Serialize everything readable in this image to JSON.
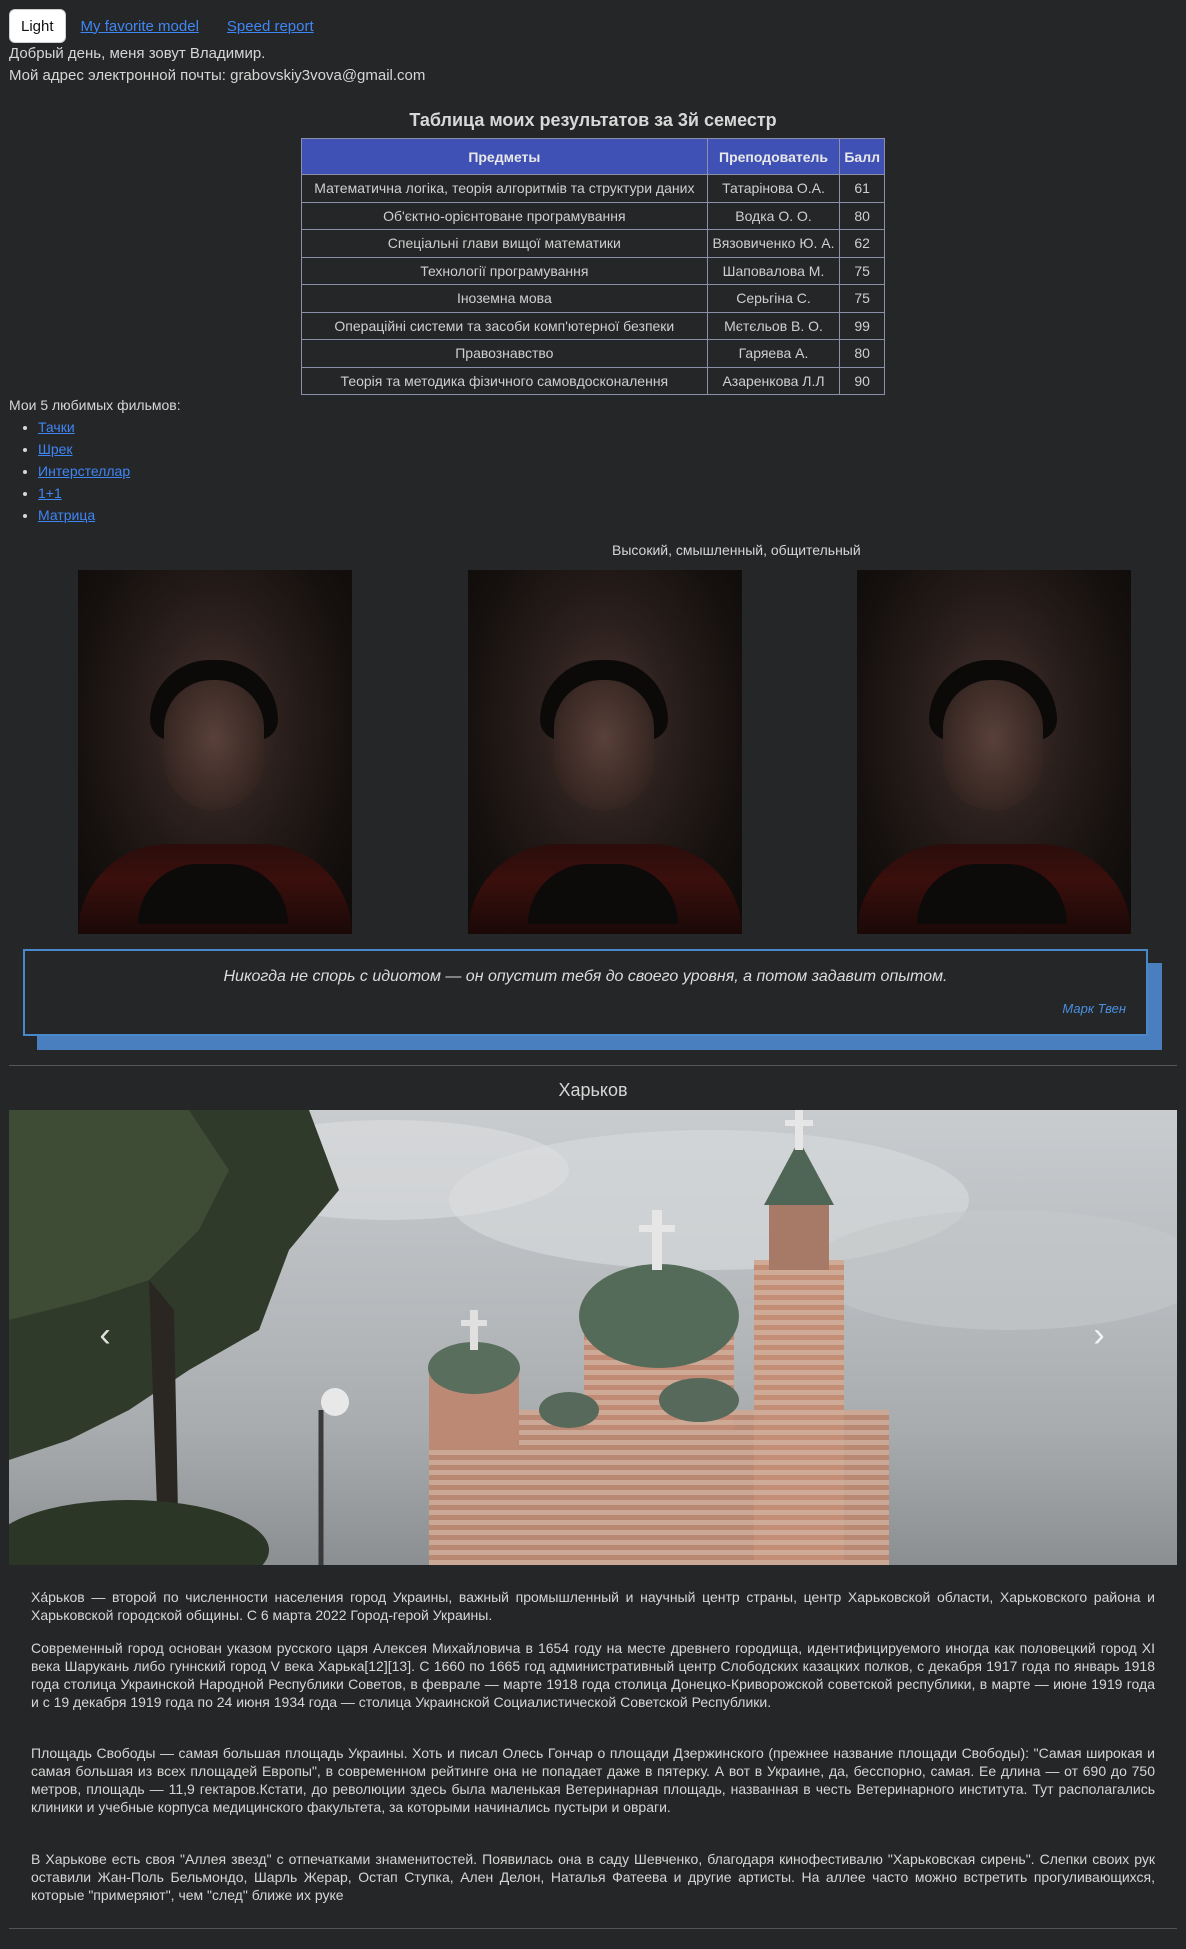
{
  "header": {
    "theme_button": "Light",
    "links": [
      "My favorite model",
      "Speed report"
    ]
  },
  "intro": {
    "greeting": "Добрый день, меня зовут Владимир.",
    "email_line": "Мой адрес электронной почты: grabovskiy3vova@gmail.com"
  },
  "grades": {
    "title": "Таблица моих результатов за 3й семестр",
    "headers": [
      "Предметы",
      "Преподователь",
      "Балл"
    ],
    "rows": [
      [
        "Математична логіка, теорія алгоритмів та структури даних",
        "Татарінова О.А.",
        "61"
      ],
      [
        "Об'єктно-орієнтоване програмування",
        "Водка О. О.",
        "80"
      ],
      [
        "Спеціальні глави вищої математики",
        "Вязовиченко Ю. А.",
        "62"
      ],
      [
        "Технології програмування",
        "Шаповалова М.",
        "75"
      ],
      [
        "Іноземна мова",
        "Серьгіна С.",
        "75"
      ],
      [
        "Операційні системи та засоби комп'ютерної безпеки",
        "Мєтєльов В. О.",
        "99"
      ],
      [
        "Правознавство",
        "Гаряева А.",
        "80"
      ],
      [
        "Теорія та методика фізичного самовдосконалення",
        "Азаренкова Л.Л",
        "90"
      ]
    ]
  },
  "films": {
    "label": "Мои 5 любимых фильмов:",
    "items": [
      "Тачки",
      "Шрек",
      "Интерстеллар",
      "1+1",
      "Матрица"
    ]
  },
  "traits": "Высокий, смышленный, общительный",
  "quote": {
    "text": "Никогда не спорь с идиотом — он опустит тебя до своего уровня, а потом задавит опытом.",
    "author": "Марк Твен"
  },
  "city": {
    "title": "Харьков",
    "carousel": {
      "prev_icon": "chevron-left-icon",
      "next_icon": "chevron-right-icon",
      "prev": "‹",
      "next": "›"
    },
    "paragraphs": [
      "Ха́рьков — второй по численности населения город Украины, важный промышленный и научный центр страны, центр Харьковской области, Харьковского района и Харьковской городской общины. С 6 марта 2022 Город-герой Украины.",
      "Современный город основан указом русского царя Алексея Михайловича в 1654 году на месте древнего городища, идентифицируемого иногда как половецкий город XI века Шарукань либо гуннский город V века Харька[12][13]. С 1660 по 1665 год административный центр Слободских казацких полков, с декабря 1917 года по январь 1918 года столица Украинской Народной Республики Советов, в феврале — марте 1918 года столица Донецко-Криворожской советской республики, в марте — июне 1919 года и с 19 декабря 1919 года по 24 июня 1934 года — столица Украинской Социалистической Советской Республики.",
      "Площадь Свободы — самая большая площадь Украины. Хоть и писал Олесь Гончар о площади Дзержинского (прежнее название площади Свободы): \"Самая широкая и самая большая из всех площадей Европы\", в современном рейтинге она не попадает даже в пятерку. А вот в Украине, да, бесспорно, самая. Ее длина — от 690 до 750 метров, площадь — 11,9 гектаров.Кстати, до революции здесь была маленькая Ветеринарная площадь, названная в честь Ветеринарного института. Тут располагались клиники и учебные корпуса медицинского факультета, за которыми начинались пустыри и овраги.",
      "В Харькове есть своя \"Аллея звезд\" с отпечатками знаменитостей. Появилась она в саду Шевченко, благодаря кинофестивалю \"Харьковская сирень\". Слепки своих рук оставили Жан-Поль Бельмондо, Шарль Жерар, Остап Ступка, Ален Делон, Наталья Фатеева и другие артисты. На аллее часто можно встретить прогуливающихся, которые \"примеряют\", чем \"след\" ближе их руке"
    ]
  },
  "colors": {
    "background": "#252627",
    "table_header": "#3f51b5",
    "link": "#3f86f5",
    "quote_border": "#4a88cc",
    "quote_shadow": "#4a7fbf"
  }
}
